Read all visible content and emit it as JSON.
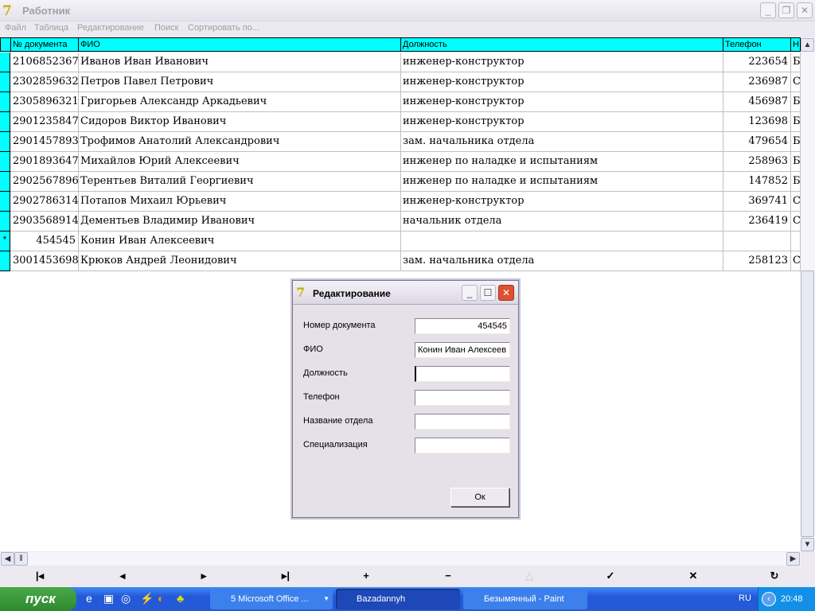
{
  "window": {
    "title": "Работник"
  },
  "menu": [
    "Файл",
    "Таблица",
    "Редактирование",
    "Поиск",
    "Сортировать по..."
  ],
  "grid": {
    "columns": [
      "№ документа",
      "ФИО",
      "Должность",
      "Телефон",
      "Н"
    ],
    "rows": [
      {
        "indicator": "",
        "doc": "2106852367",
        "fio": "Иванов Иван Иванович",
        "post": "инженер-конструктор",
        "phone": "223654",
        "extra": "Б"
      },
      {
        "indicator": "",
        "doc": "2302859632",
        "fio": "Петров Павел Петрович",
        "post": "инженер-конструктор",
        "phone": "236987",
        "extra": "С"
      },
      {
        "indicator": "",
        "doc": "2305896321",
        "fio": "Григорьев Александр Аркадьевич",
        "post": "инженер-конструктор",
        "phone": "456987",
        "extra": "Б"
      },
      {
        "indicator": "",
        "doc": "2901235847",
        "fio": "Сидоров Виктор Иванович",
        "post": "инженер-конструктор",
        "phone": "123698",
        "extra": "Б"
      },
      {
        "indicator": "",
        "doc": "2901457893",
        "fio": "Трофимов Анатолий Александрович",
        "post": "зам. начальника отдела",
        "phone": "479654",
        "extra": "Б"
      },
      {
        "indicator": "",
        "doc": "2901893647",
        "fio": "Михайлов Юрий Алексеевич",
        "post": "инженер по наладке и испытаниям",
        "phone": "258963",
        "extra": "Б"
      },
      {
        "indicator": "",
        "doc": "2902567896",
        "fio": "Терентьев Виталий Георгиевич",
        "post": "инженер по наладке и испытаниям",
        "phone": "147852",
        "extra": "Б"
      },
      {
        "indicator": "",
        "doc": "2902786314",
        "fio": "Потапов Михаил Юрьевич",
        "post": "инженер-конструктор",
        "phone": "369741",
        "extra": "С"
      },
      {
        "indicator": "",
        "doc": "2903568914",
        "fio": "Дементьев Владимир Иванович",
        "post": "начальник отдела",
        "phone": "236419",
        "extra": "С"
      },
      {
        "indicator": "*",
        "doc": "454545",
        "fio": "Конин Иван Алексеевич",
        "post": "",
        "phone": "",
        "extra": ""
      },
      {
        "indicator": "",
        "doc": "3001453698",
        "fio": "Крюков Андрей Леонидович",
        "post": "зам. начальника отдела",
        "phone": "258123",
        "extra": "С"
      }
    ]
  },
  "navigator": [
    "first",
    "prior",
    "next",
    "last",
    "insert",
    "delete",
    "edit",
    "post",
    "cancel",
    "refresh"
  ],
  "dialog": {
    "title": "Редактирование",
    "fields": [
      {
        "label": "Номер документа",
        "value": "454545"
      },
      {
        "label": "ФИО",
        "value": "Конин Иван Алексеев"
      },
      {
        "label": "Должность",
        "value": ""
      },
      {
        "label": "Телефон",
        "value": ""
      },
      {
        "label": "Название отдела",
        "value": ""
      },
      {
        "label": "Специализация",
        "value": ""
      }
    ],
    "ok_label": "Ок"
  },
  "taskbar": {
    "start_label": "пуск",
    "tasks": [
      "5 Microsoft Office ...",
      "Bazadannyh",
      "Безымянный - Paint"
    ],
    "lang": "RU",
    "clock": "20:48"
  }
}
